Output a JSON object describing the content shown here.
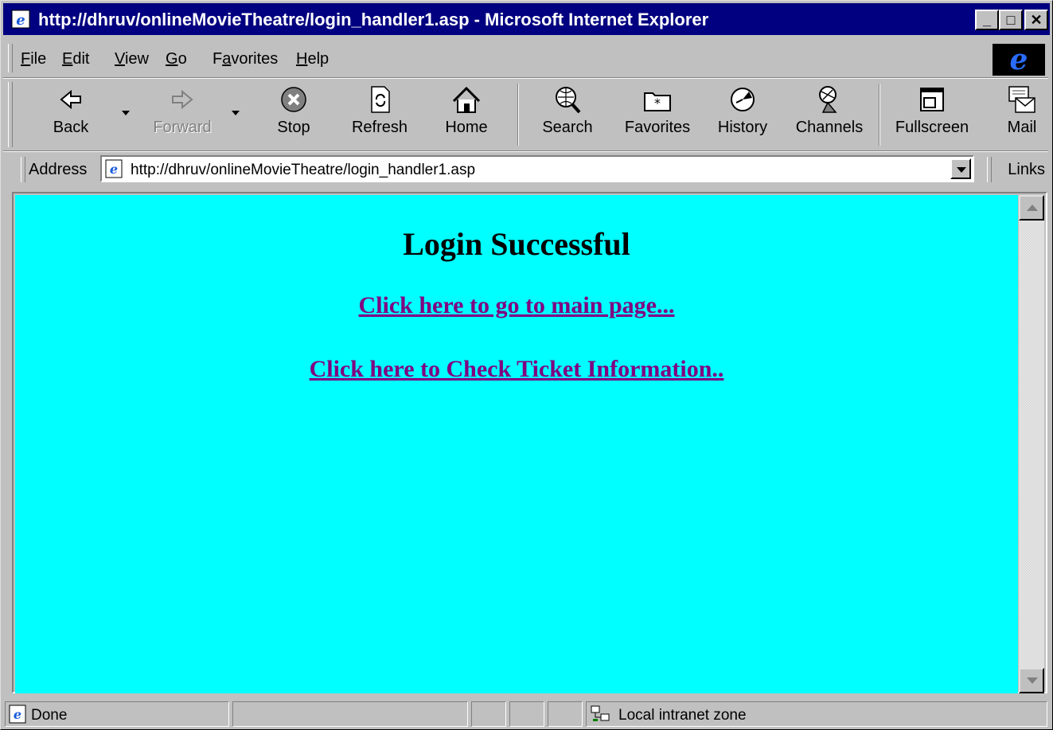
{
  "window": {
    "title": "http://dhruv/onlineMovieTheatre/login_handler1.asp - Microsoft Internet Explorer",
    "minimize": "_",
    "maximize": "□",
    "close": "✕"
  },
  "menu": {
    "items": [
      {
        "label": "File",
        "accel": "F",
        "rest": "ile"
      },
      {
        "label": "Edit",
        "accel": "E",
        "rest": "dit"
      },
      {
        "label": "View",
        "accel": "V",
        "rest": "iew"
      },
      {
        "label": "Go",
        "accel": "G",
        "rest": "o"
      },
      {
        "label": "Favorites",
        "pre": "F",
        "accel": "a",
        "rest": "vorites"
      },
      {
        "label": "Help",
        "accel": "H",
        "rest": "elp"
      }
    ]
  },
  "toolbar": {
    "back": "Back",
    "forward": "Forward",
    "stop": "Stop",
    "refresh": "Refresh",
    "home": "Home",
    "search": "Search",
    "favorites": "Favorites",
    "history": "History",
    "channels": "Channels",
    "fullscreen": "Fullscreen",
    "mail": "Mail"
  },
  "address": {
    "label": "Address",
    "url": "http://dhruv/onlineMovieTheatre/login_handler1.asp",
    "links": "Links"
  },
  "page": {
    "heading": "Login Successful",
    "link_main": "Click here to go to main page...",
    "link_ticket": "Click here to Check Ticket Information..",
    "background": "#00ffff",
    "link_color": "#800080"
  },
  "status": {
    "text": "Done",
    "zone": "Local intranet zone"
  }
}
